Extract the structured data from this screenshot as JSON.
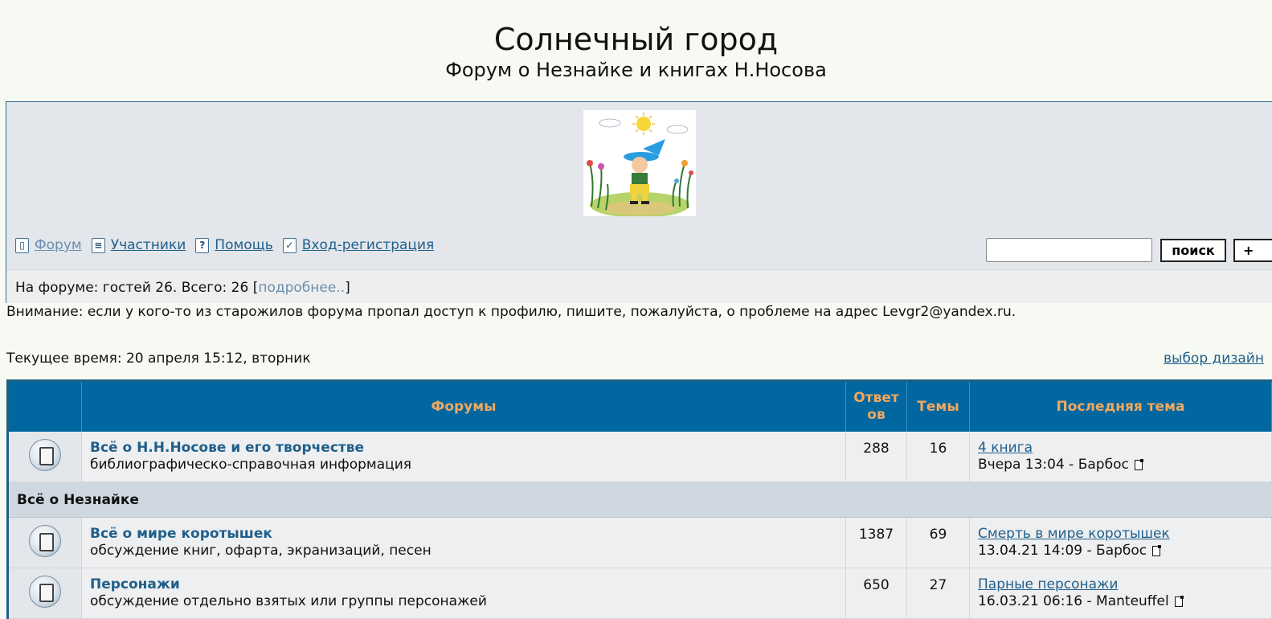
{
  "header": {
    "title": "Солнечный город",
    "subtitle": "Форум о Незнайке и книгах Н.Носова"
  },
  "nav": [
    {
      "label": "Форум",
      "icon": "forum-icon"
    },
    {
      "label": "Участники",
      "icon": "list-icon"
    },
    {
      "label": "Помощь",
      "icon": "help-icon"
    },
    {
      "label": "Вход-регистрация",
      "icon": "checkmark-icon"
    }
  ],
  "search": {
    "value": "",
    "button": "поиск",
    "extra_button": "+"
  },
  "online": {
    "text": "На форуме: гостей 26. Всего: 26 [",
    "link": "подробнее..",
    "close": "]"
  },
  "notice": "Внимание: если у кого-то из старожилов форума пропал доступ к профилю, пишите, пожалуйста, о проблеме на адрес Levgr2@yandex.ru.",
  "time": "Текущее время: 20 апреля 15:12, вторник",
  "design_link": "выбор дизайн",
  "table": {
    "headers": {
      "forums": "Форумы",
      "answers": "Ответов",
      "answers_line1": "Ответ",
      "answers_line2": "ов",
      "topics": "Темы",
      "last": "Последняя тема"
    },
    "rows": [
      {
        "name": "Всё о Н.Н.Носове и его творчестве",
        "desc": "библиографическо-справочная информация",
        "answers": "288",
        "topics": "16",
        "last_topic": "4 книга",
        "last_meta": "Вчера 13:04 - Барбос"
      }
    ],
    "category": "Всё о Незнайке",
    "rows2": [
      {
        "name": "Всё о мире коротышек",
        "desc": "обсуждение книг, офарта, экранизаций, песен",
        "answers": "1387",
        "topics": "69",
        "last_topic": "Смерть в мире коротышек",
        "last_meta": "13.04.21 14:09 - Барбос"
      },
      {
        "name": "Персонажи",
        "desc": "обсуждение отдельно взятых или группы персонажей",
        "answers": "650",
        "topics": "27",
        "last_topic": "Парные персонажи",
        "last_meta": "16.03.21 06:16 - Manteuffel"
      }
    ]
  }
}
